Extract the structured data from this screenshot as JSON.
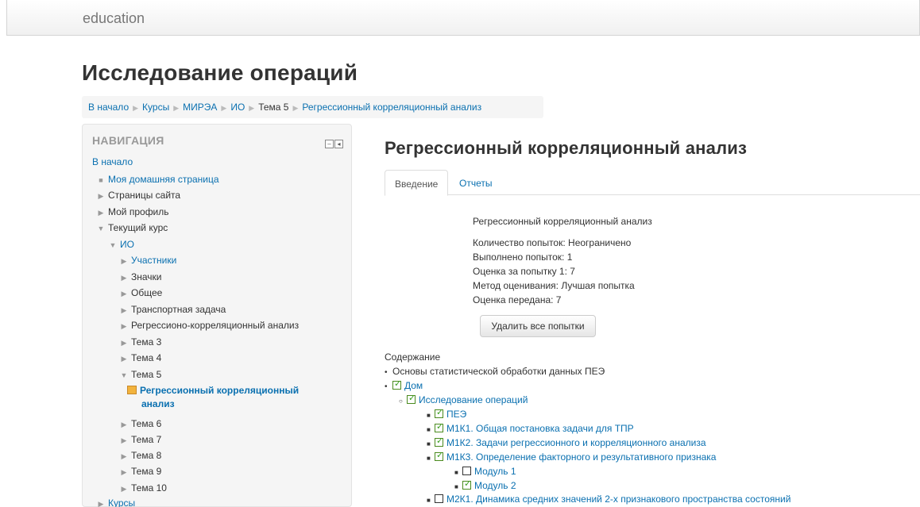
{
  "brand": "education",
  "page_title": "Исследование операций",
  "breadcrumb": [
    "В начало",
    "Курсы",
    "МИРЭА",
    "ИО",
    "Тема 5",
    "Регрессионный корреляционный анализ"
  ],
  "navigation": {
    "header": "НАВИГАЦИЯ",
    "home": "В начало",
    "my_home": "Моя домашняя страница",
    "site_pages": "Страницы сайта",
    "my_profile": "Мой профиль",
    "current_course": "Текущий курс",
    "course": "ИО",
    "course_items": {
      "participants": "Участники",
      "badges": "Значки",
      "general": "Общее",
      "transport": "Транспортная задача",
      "regression": "Регрессионо-корреляционный анализ",
      "topic3": "Тема 3",
      "topic4": "Тема 4",
      "topic5": "Тема 5",
      "current_line1": "Регрессионный корреляционный",
      "current_line2": "анализ",
      "topic6": "Тема 6",
      "topic7": "Тема 7",
      "topic8": "Тема 8",
      "topic9": "Тема 9",
      "topic10": "Тема 10"
    },
    "courses": "Курсы"
  },
  "main": {
    "title": "Регрессионный корреляционный анализ",
    "tabs": {
      "intro": "Введение",
      "reports": "Отчеты"
    },
    "info": {
      "name": "Регрессионный корреляционный анализ",
      "attempts_allowed": "Количество попыток: Неограничено",
      "attempts_done": "Выполнено попыток: 1",
      "attempt_grade": "Оценка за попытку 1: 7",
      "grading_method": "Метод оценивания: Лучшая попытка",
      "grade_reported": "Оценка передана: 7"
    },
    "delete_button": "Удалить все попытки",
    "toc": {
      "label": "Содержание",
      "basics": "Основы статистической обработки данных ПЕЭ",
      "home": "Дом",
      "operations": "Исследование операций",
      "pee": "ПЕЭ",
      "m1k1": "М1К1. Общая постановка задачи для ТПР",
      "m1k2": "М1К2. Задачи регрессионного и корреляционного анализа",
      "m1k3": "М1К3. Определение факторного и результативного признака",
      "module1": "Модуль 1",
      "module2": "Модуль 2",
      "m2k1": "М2К1. Динамика средних значений 2-х признакового пространства состояний"
    }
  }
}
